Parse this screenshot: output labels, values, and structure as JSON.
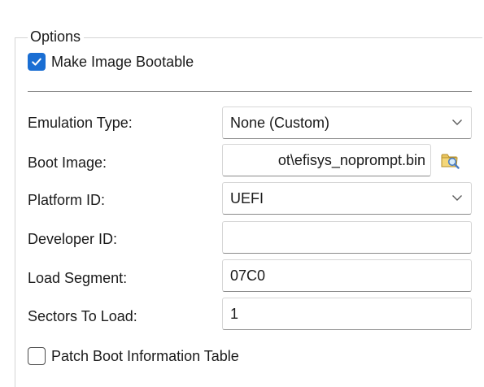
{
  "options": {
    "group_title": "Options",
    "make_bootable": {
      "label": "Make Image Bootable",
      "checked": true
    },
    "emulation_type": {
      "label": "Emulation Type:",
      "value": "None (Custom)"
    },
    "boot_image": {
      "label": "Boot Image:",
      "value": "ot\\efisys_noprompt.bin"
    },
    "platform_id": {
      "label": "Platform ID:",
      "value": "UEFI"
    },
    "developer_id": {
      "label": "Developer ID:",
      "value": ""
    },
    "load_segment": {
      "label": "Load Segment:",
      "value": "07C0"
    },
    "sectors_to_load": {
      "label": "Sectors To Load:",
      "value": "1"
    },
    "patch_boot_info": {
      "label": "Patch Boot Information Table",
      "checked": false
    }
  },
  "colors": {
    "accent": "#1a6ed3",
    "separator": "#8a8a8a",
    "group_border": "#d4d4d4"
  },
  "icons": {
    "browse": "folder-search-icon",
    "dropdown": "chevron-down-icon",
    "check": "checkmark-icon"
  }
}
